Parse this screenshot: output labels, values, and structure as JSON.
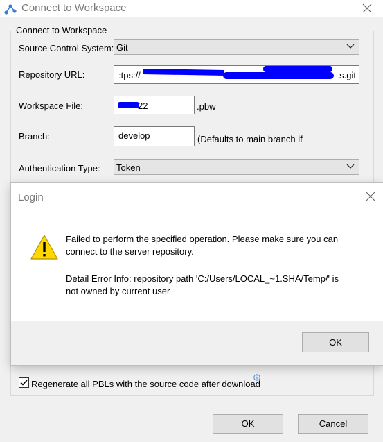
{
  "window": {
    "title": "Connect to Workspace"
  },
  "group": {
    "legend": "Connect to Workspace"
  },
  "form": {
    "source_control_label": "Source Control System:",
    "source_control_value": "Git",
    "repo_url_label": "Repository URL:",
    "repo_url_prefix": ":tps://",
    "repo_url_suffix": "s.git",
    "workspace_file_label": "Workspace File:",
    "workspace_file_value": "22",
    "workspace_file_ext": ".pbw",
    "branch_label": "Branch:",
    "branch_value": "develop",
    "branch_hint": "(Defaults to main branch if",
    "auth_type_label": "Authentication Type:",
    "auth_type_value": "Token",
    "regenerate_label": "Regenerate all PBLs with the source code after download",
    "regenerate_checked": true
  },
  "buttons": {
    "ok": "OK",
    "cancel": "Cancel"
  },
  "login_dialog": {
    "title": "Login",
    "message_line1": "Failed to perform the specified operation. Please make sure you can",
    "message_line2": "connect to the server repository.",
    "detail_line1": "Detail Error Info: repository path 'C:/Users/LOCAL_~1.SHA/Temp/' is",
    "detail_line2": "not owned by current user",
    "ok": "OK"
  },
  "colors": {
    "redaction": "#0000ff",
    "warning": "#ffd800"
  }
}
